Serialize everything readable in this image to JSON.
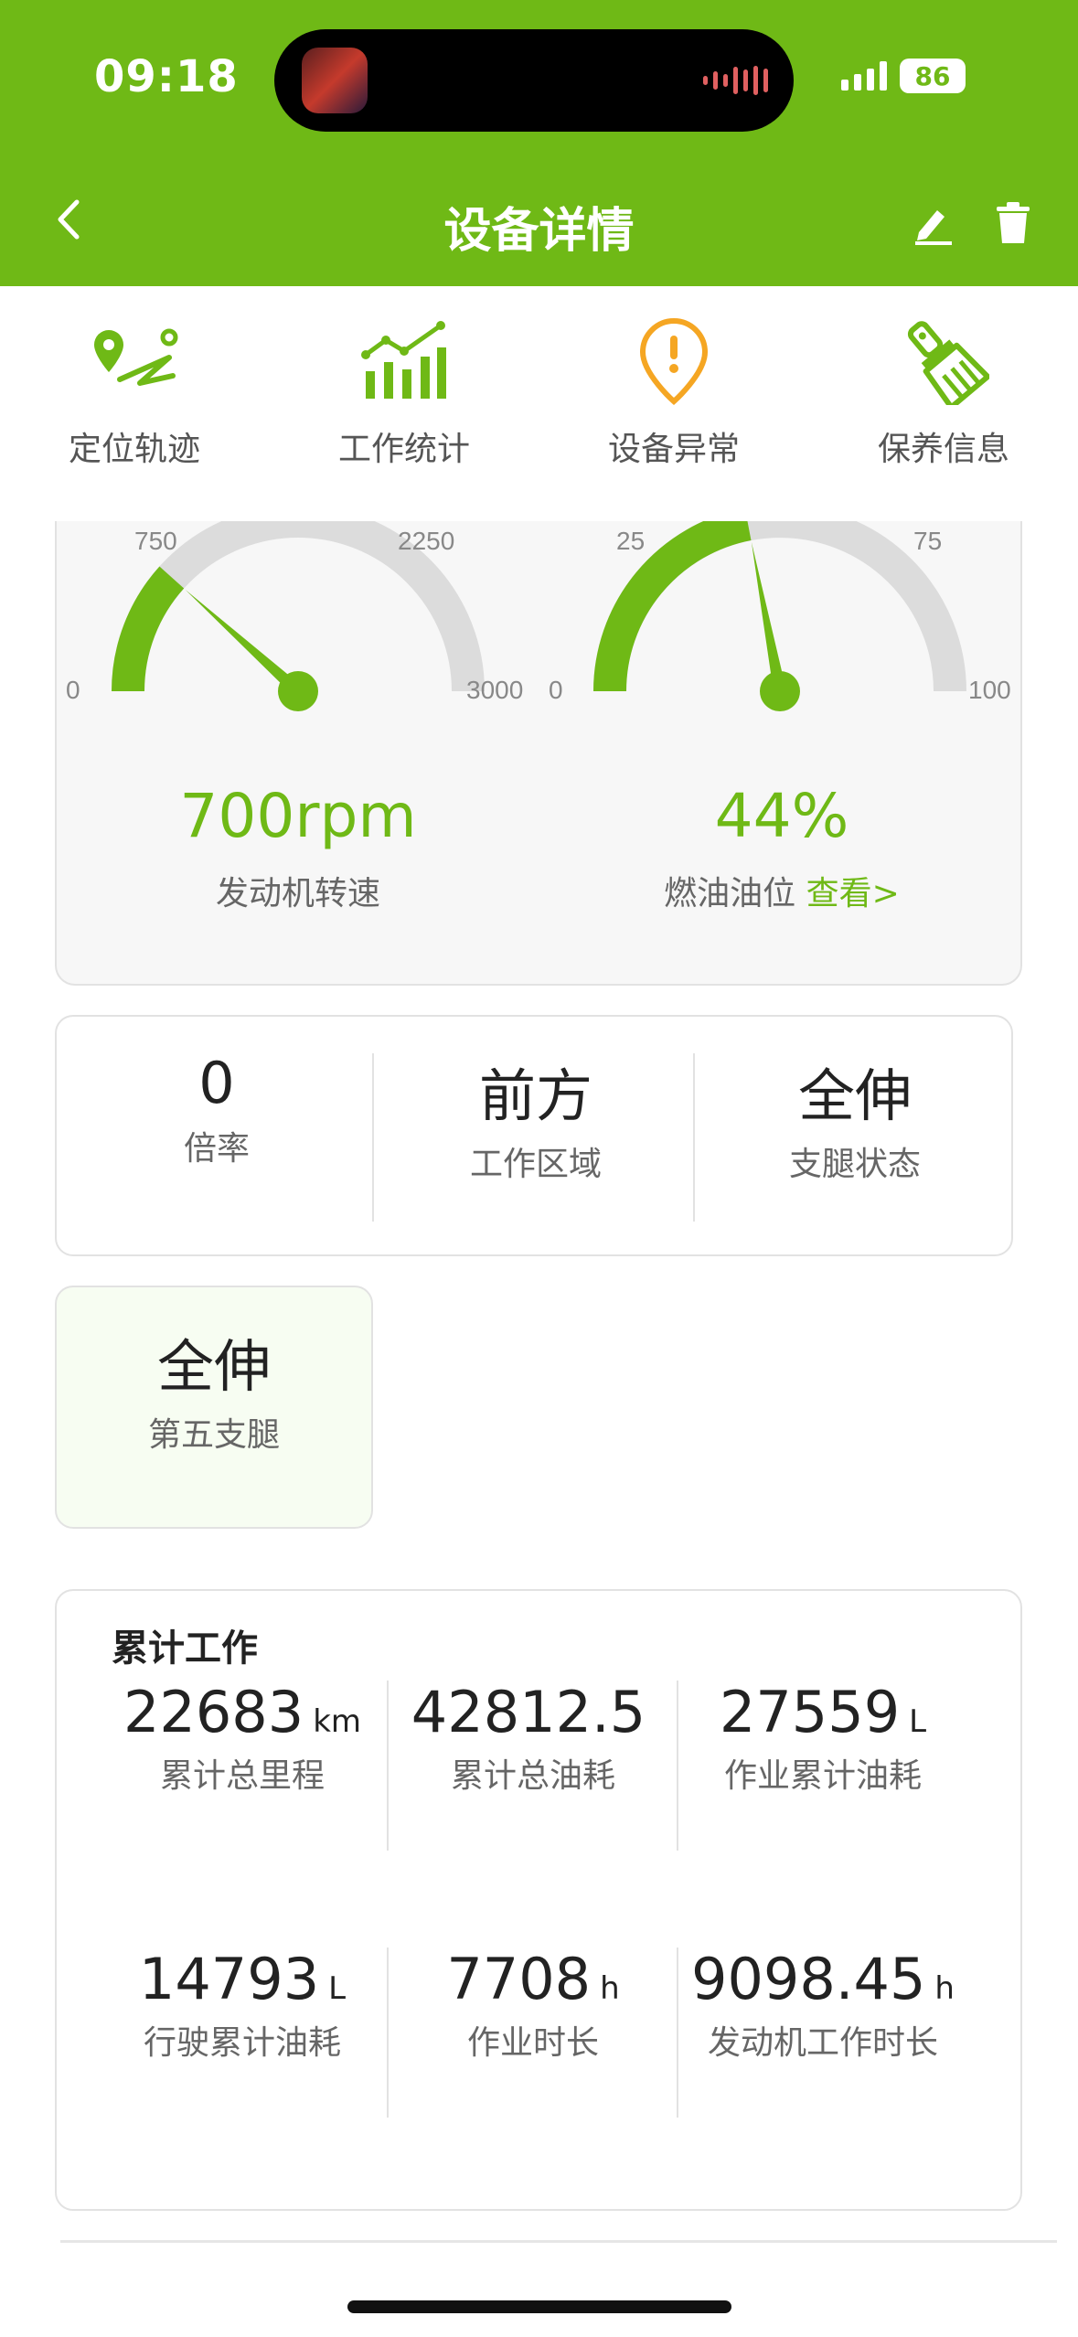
{
  "status_bar": {
    "time": "09:18",
    "battery": "86",
    "signal_icon": "cellular-signal-icon",
    "battery_icon": "battery-icon"
  },
  "nav": {
    "title": "设备详情",
    "back_icon": "chevron-left-icon",
    "edit_icon": "edit-icon",
    "delete_icon": "trash-icon"
  },
  "quick_actions": [
    {
      "label": "定位轨迹",
      "icon": "location-track-icon",
      "color": "#6fb916"
    },
    {
      "label": "工作统计",
      "icon": "bar-chart-icon",
      "color": "#6fb916"
    },
    {
      "label": "设备异常",
      "icon": "alert-pin-icon",
      "color": "#f5a623"
    },
    {
      "label": "保养信息",
      "icon": "brush-icon",
      "color": "#6fb916"
    }
  ],
  "gauges": {
    "engine": {
      "min": "0",
      "t1": "750",
      "t3": "2250",
      "max": "3000",
      "value": 700,
      "range_max": 3000,
      "display": "700rpm",
      "label": "发动机转速"
    },
    "fuel": {
      "min": "0",
      "t1": "25",
      "t3": "75",
      "max": "100",
      "value": 44,
      "range_max": 100,
      "display": "44%",
      "label": "燃油油位",
      "link": "查看>"
    },
    "colors": {
      "active": "#6fb916",
      "track": "#dcdcdc"
    }
  },
  "status_row": [
    {
      "value": "0",
      "label": "倍率"
    },
    {
      "value": "前方",
      "label": "工作区域"
    },
    {
      "value": "全伸",
      "label": "支腿状态"
    }
  ],
  "fifth_leg": {
    "value": "全伸",
    "label": "第五支腿"
  },
  "cumulative": {
    "title": "累计工作",
    "items": [
      {
        "num": "22683",
        "unit": "km",
        "label": "累计总里程"
      },
      {
        "num": "42812.5",
        "unit": "",
        "label": "累计总油耗"
      },
      {
        "num": "27559",
        "unit": "L",
        "label": "作业累计油耗"
      },
      {
        "num": "14793",
        "unit": "L",
        "label": "行驶累计油耗"
      },
      {
        "num": "7708",
        "unit": "h",
        "label": "作业时长"
      },
      {
        "num": "9098.45",
        "unit": "h",
        "label": "发动机工作时长"
      }
    ]
  }
}
